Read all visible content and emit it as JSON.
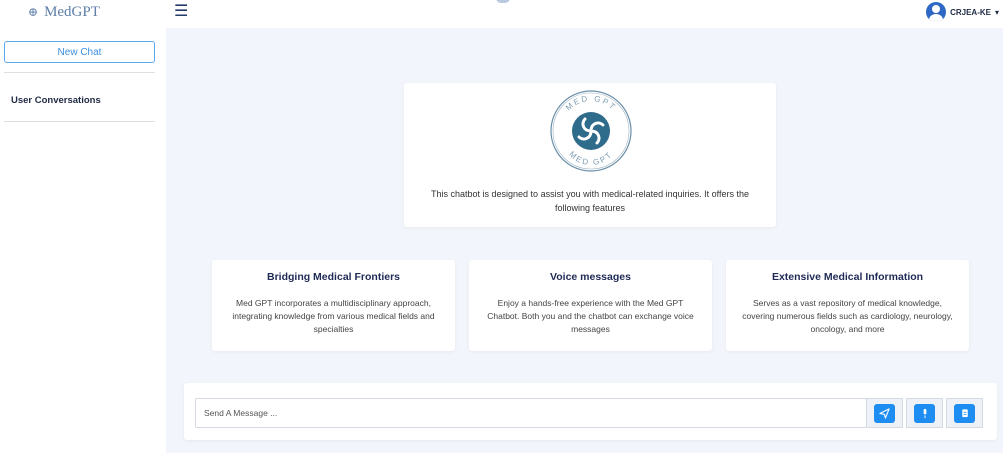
{
  "app": {
    "logo_text": "MedGPT",
    "logo_mark": "⊕"
  },
  "sidebar": {
    "new_chat_label": "New Chat",
    "section_title": "User Conversations"
  },
  "header": {
    "username": "CRJEA-KE",
    "menu_icon": "☰"
  },
  "intro": {
    "emblem_text_top": "MED GPT",
    "emblem_text_bottom": "MED GPT",
    "description": "This chatbot is designed to assist you with medical-related inquiries. It offers the following features"
  },
  "features": [
    {
      "title": "Bridging Medical Frontiers",
      "description": "Med GPT incorporates a multidisciplinary approach, integrating knowledge from various medical fields and specialties"
    },
    {
      "title": "Voice messages",
      "description": "Enjoy a hands-free experience with the Med GPT Chatbot. Both you and the chatbot can exchange voice messages"
    },
    {
      "title": "Extensive Medical Information",
      "description": "Serves as a vast repository of medical knowledge, covering numerous fields such as cardiology, neurology, oncology, and more"
    }
  ],
  "composer": {
    "placeholder": "Send A Message ...",
    "send_icon": "send-icon",
    "mic_icon": "microphone-icon",
    "file_icon": "document-icon"
  },
  "colors": {
    "accent": "#1d8df2",
    "brand": "#5f7ea8",
    "emblem": "#2f6b8a",
    "background": "#f2f5fb"
  }
}
